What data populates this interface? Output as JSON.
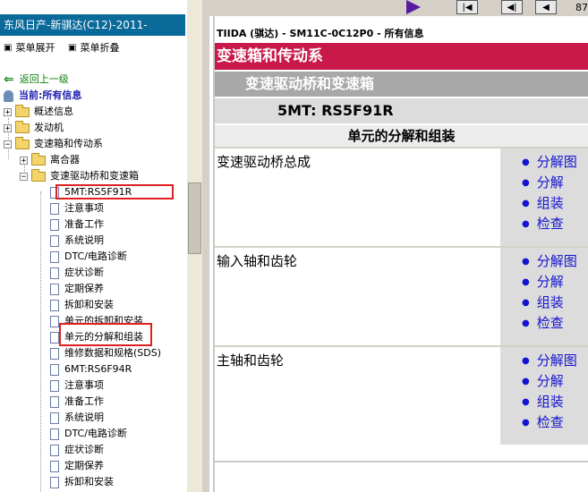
{
  "left": {
    "title": "东风日产-新骐达(C12)-2011-",
    "expand_label": "菜单展开",
    "collapse_label": "菜单折叠",
    "back_label": "返回上一级",
    "current_label": "当前:所有信息",
    "top_items": [
      "概述信息",
      "发动机",
      "变速箱和传动系"
    ],
    "sub_items": [
      "离合器",
      "变速驱动桥和变速箱"
    ],
    "doc_items": [
      "5MT:RS5F91R",
      "注意事项",
      "准备工作",
      "系统说明",
      "DTC/电路诊断",
      "症状诊断",
      "定期保养",
      "拆卸和安装",
      "单元的拆卸和安装",
      "单元的分解和组装",
      "维修数据和规格(SDS)",
      "6MT:RS6F94R",
      "注意事项",
      "准备工作",
      "系统说明",
      "DTC/电路诊断",
      "症状诊断",
      "定期保养",
      "拆卸和安装"
    ]
  },
  "toolbar": {
    "page_num": "87"
  },
  "content": {
    "breadcrumb": "TIIDA (骐达) - SM11C-0C12P0 - 所有信息",
    "section_title": "变速箱和传动系",
    "sub_title": "变速驱动桥和变速箱",
    "model_title": "5MT: RS5F91R",
    "unit_title": "单元的分解和组装",
    "sections": [
      {
        "name": "变速驱动桥总成",
        "links": [
          "分解图",
          "分解",
          "组装",
          "检查"
        ]
      },
      {
        "name": "输入轴和齿轮",
        "links": [
          "分解图",
          "分解",
          "组装",
          "检查"
        ]
      },
      {
        "name": "主轴和齿轮",
        "links": [
          "分解图",
          "分解",
          "组装",
          "检查"
        ]
      }
    ]
  },
  "colors": {
    "header_blue": "#0a6a9a",
    "section_red": "#c8194a",
    "link_blue": "#1414d0",
    "highlight_red": "#e02020"
  }
}
